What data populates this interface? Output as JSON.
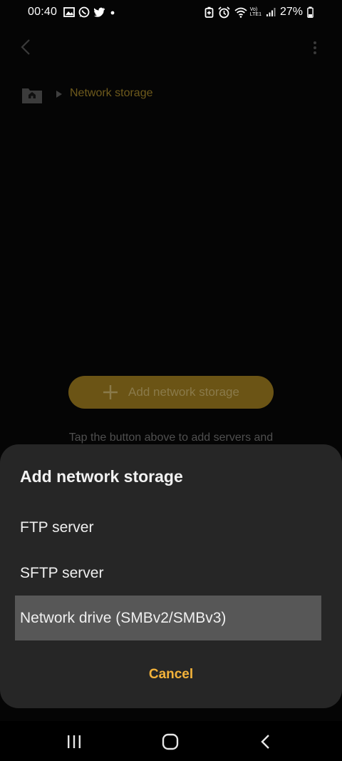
{
  "status_bar": {
    "time": "00:40",
    "battery_percent": "27%",
    "network_label_top": "Vo)",
    "network_label_bottom": "LTE1"
  },
  "background": {
    "breadcrumb_label": "Network storage",
    "add_button_label": "Add network storage",
    "hint_text": "Tap the button above to add servers and"
  },
  "sheet": {
    "title": "Add network storage",
    "options": [
      {
        "label": "FTP server",
        "selected": false
      },
      {
        "label": "SFTP server",
        "selected": false
      },
      {
        "label": "Network drive (SMBv2/SMBv3)",
        "selected": true
      }
    ],
    "cancel_label": "Cancel"
  },
  "icons": {
    "status_left": [
      "gallery-icon",
      "whatsapp-icon",
      "twitter-icon",
      "dot-icon"
    ],
    "status_right": [
      "battery-saver-icon",
      "alarm-icon",
      "wifi-icon",
      "signal-icon",
      "battery-icon"
    ],
    "nav": [
      "recent-apps-icon",
      "home-icon",
      "back-icon"
    ]
  },
  "colors": {
    "accent": "#f3b23a",
    "sheet_bg": "#262626",
    "selected_bg": "#575757",
    "dim_accent": "#6b5415"
  }
}
